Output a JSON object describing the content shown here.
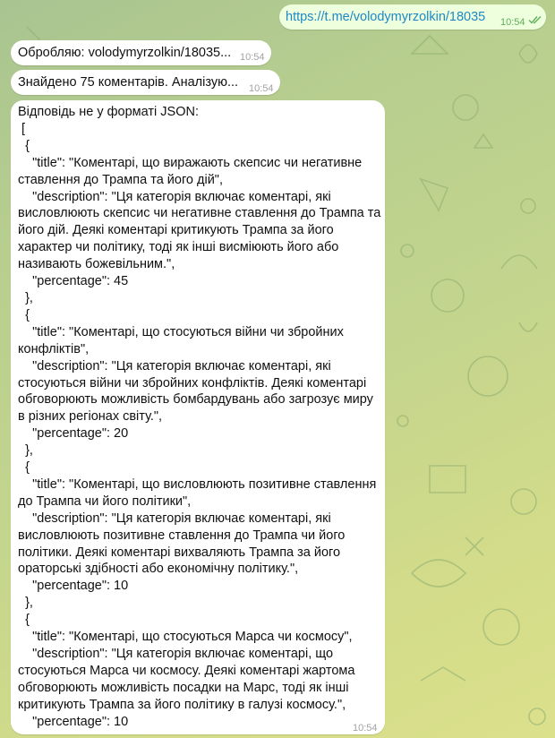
{
  "chat": {
    "messages": [
      {
        "direction": "outgoing",
        "text": "https://t.me/volodymyrzolkin/18035",
        "time": "10:54",
        "status_icon": "double-check-icon"
      },
      {
        "direction": "incoming",
        "text": "Обробляю: volodymyrzolkin/18035...",
        "time": "10:54"
      },
      {
        "direction": "incoming",
        "text": "Знайдено 75 коментарів. Аналізую...",
        "time": "10:54"
      },
      {
        "direction": "incoming",
        "text": "Відповідь не у форматі JSON:\n [\n  {\n    \"title\": \"Коментарі, що виражають скепсис чи негативне ставлення до Трампа та його дій\",\n    \"description\": \"Ця категорія включає коментарі, які висловлюють скепсис чи негативне ставлення до Трампа та його дій. Деякі коментарі критикують Трампа за його характер чи політику, тоді як інші висміюють його або називають божевільним.\",\n    \"percentage\": 45\n  },\n  {\n    \"title\": \"Коментарі, що стосуються війни чи збройних конфліктів\",\n    \"description\": \"Ця категорія включає коментарі, які стосуються війни чи збройних конфліктів. Деякі коментарі обговорюють можливість бомбардувань або загрозує миру в різних регіонах світу.\",\n    \"percentage\": 20\n  },\n  {\n    \"title\": \"Коментарі, що висловлюють позитивне ставлення до Трампа чи його політики\",\n    \"description\": \"Ця категорія включає коментарі, які висловлюють позитивне ставлення до Трампа чи його політики. Деякі коментарі вихваляють Трампа за його ораторські здібності або економічну політику.\",\n    \"percentage\": 10\n  },\n  {\n    \"title\": \"Коментарі, що стосуються Марса чи космосу\",\n    \"description\": \"Ця категорія включає коментарі, що стосуються Марса чи космосу. Деякі коментарі жартома обговорюють можливість посадки на Марс, тоді як інші критикують Трампа за його політику в галузі космосу.\",\n    \"percentage\": 10",
        "time": "10:54"
      }
    ]
  },
  "colors": {
    "link": "#1e88c7",
    "outgoing_bubble": "#eeffde",
    "incoming_bubble": "#ffffff",
    "outgoing_time": "#5fae5b"
  }
}
